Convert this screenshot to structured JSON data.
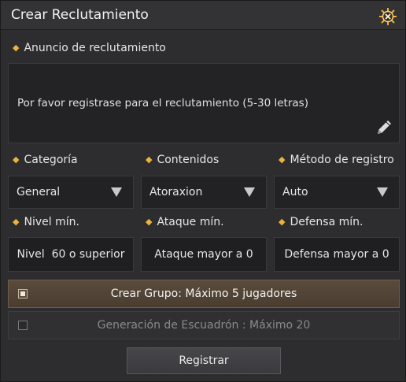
{
  "window": {
    "title": "Crear Reclutamiento"
  },
  "announcement": {
    "label": "Anuncio de reclutamiento",
    "text": "Por favor registrase para el reclutamiento (5-30 letras)"
  },
  "category": {
    "label": "Categoría",
    "value": "General"
  },
  "contents": {
    "label": "Contenidos",
    "value": "Atoraxion"
  },
  "registration_method": {
    "label": "Método de registro",
    "value": "Auto"
  },
  "min_level": {
    "label": "Nivel mín.",
    "value": "Nivel  60 o superior"
  },
  "min_attack": {
    "label": "Ataque mín.",
    "value": "Ataque mayor a 0"
  },
  "min_defense": {
    "label": "Defensa mín.",
    "value": "Defensa mayor a 0"
  },
  "options": {
    "group": {
      "label": "Crear Grupo: Máximo 5 jugadores",
      "checked": true
    },
    "squad": {
      "label": "Generación de Escuadrón : Máximo 20",
      "checked": false
    }
  },
  "register_button": {
    "label": "Registrar"
  },
  "colors": {
    "accent": "#e8b43c",
    "active_row": "#5a4b3c",
    "background": "#2d2d2f"
  },
  "icons": {
    "close": "close-icon",
    "edit": "pencil-icon",
    "bullet": "diamond-icon",
    "dropdown": "chevron-down-icon"
  }
}
